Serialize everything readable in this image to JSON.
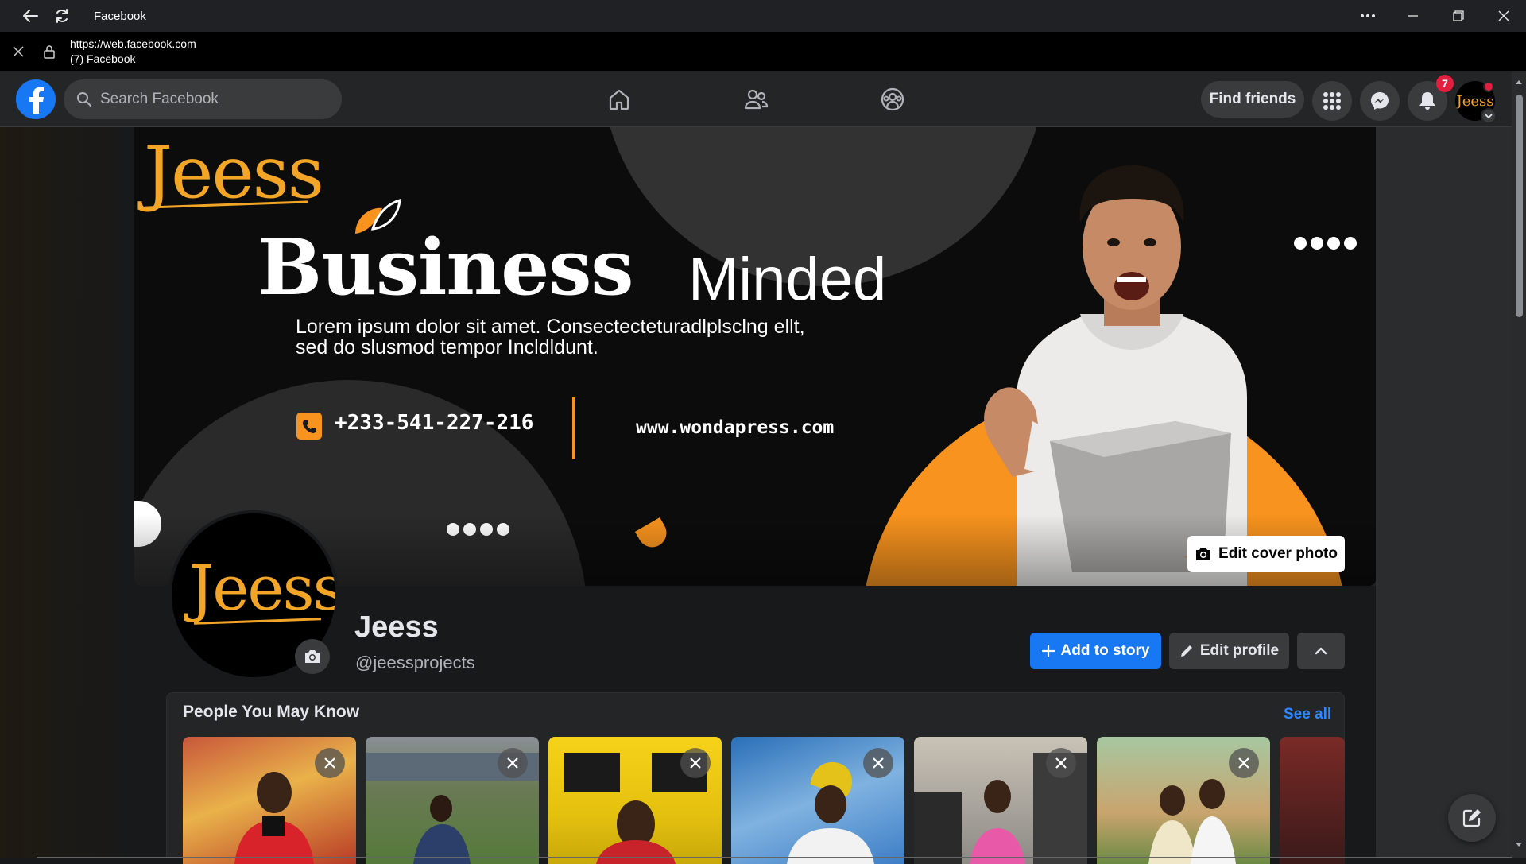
{
  "window": {
    "title": "Facebook"
  },
  "address": {
    "url": "https://web.facebook.com",
    "page_title": "(7) Facebook"
  },
  "nav": {
    "search_placeholder": "Search Facebook",
    "find_friends": "Find friends",
    "notification_count": "7",
    "avatar_label": "Jeess"
  },
  "cover": {
    "logo": "Jeess",
    "headline_bold": "Business",
    "headline_light": "Minded",
    "lorem_line1": "Lorem ipsum dolor sit amet. Consectecteturadlplsclng ellt,",
    "lorem_line2": "sed do slusmod tempor Incldldunt.",
    "phone": "+233-541-227-216",
    "website": "www.wondapress.com",
    "edit_cover": "Edit cover photo"
  },
  "profile": {
    "logo": "Jeess",
    "name": "Jeess",
    "handle": "@jeessprojects",
    "add_story": "Add to story",
    "edit_profile": "Edit profile"
  },
  "pymk": {
    "title": "People You May Know",
    "see_all": "See all"
  },
  "colors": {
    "fb_blue": "#1877f2",
    "accent_orange": "#f7931e",
    "bg": "#18191a",
    "surface": "#242526"
  }
}
